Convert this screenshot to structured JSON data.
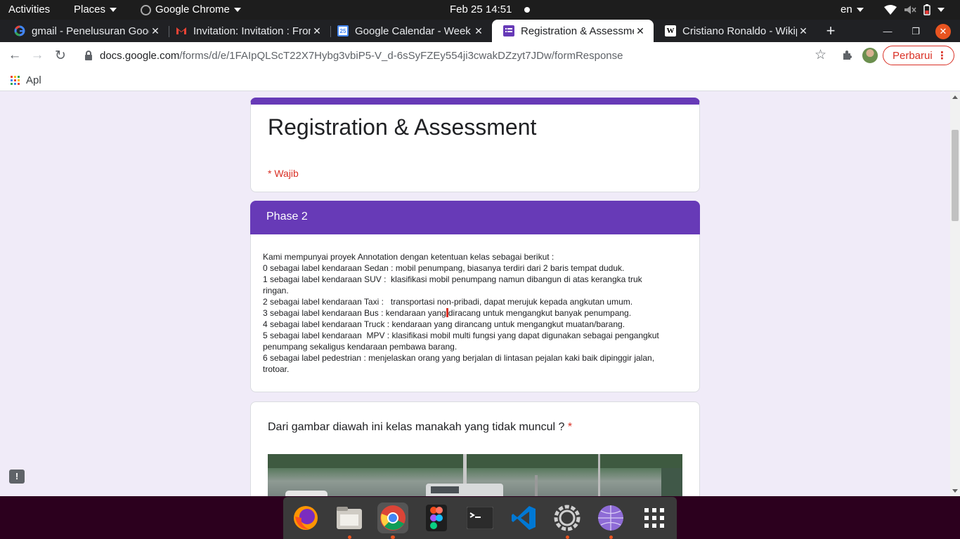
{
  "topbar": {
    "activities": "Activities",
    "places": "Places",
    "app": "Google Chrome",
    "datetime": "Feb 25  14:51",
    "lang": "en"
  },
  "tabs": [
    {
      "title": "gmail - Penelusuran Google",
      "icon": "google-icon"
    },
    {
      "title": "Invitation: Invitation : From",
      "icon": "gmail-icon"
    },
    {
      "title": "Google Calendar - Week",
      "icon": "calendar-icon"
    },
    {
      "title": "Registration & Assessment",
      "icon": "forms-icon",
      "active": true
    },
    {
      "title": "Cristiano Ronaldo - Wikipedia",
      "icon": "wikipedia-icon"
    }
  ],
  "toolbar": {
    "url_host": "docs.google.com",
    "url_path": "/forms/d/e/1FAIpQLScT22X7Hybg3vbiP5-V_d-6sSyFZEy554ji3cwakDZzyt7JDw/formResponse",
    "update_label": "Perbarui"
  },
  "bookmarks": {
    "apps_label": "Apl"
  },
  "form": {
    "title": "Registration & Assessment",
    "required_note": "* Wajib",
    "section_title": "Phase 2",
    "description": [
      "Kami mempunyai proyek Annotation dengan ketentuan kelas sebagai berikut :",
      "0 sebagai label kendaraan Sedan : mobil penumpang, biasanya terdiri dari 2 baris tempat duduk.",
      "1 sebagai label kendaraan SUV :  klasifikasi mobil penumpang namun dibangun di atas kerangka truk",
      "ringan.",
      "2 sebagai label kendaraan Taxi :   transportasi non-pribadi, dapat merujuk kepada angkutan umum.",
      "3 sebagai label kendaraan Bus : kendaraan yang",
      "diracang untuk mengangkut banyak penumpang.",
      "4 sebagai label kendaraan Truck : kendaraan yang dirancang untuk mengangkut muatan/barang.",
      "5 sebagai label kendaraan  MPV : klasifikasi mobil multi fungsi yang dapat digunakan sebagai pengangkut",
      "penumpang sekaligus kendaraan pembawa barang.",
      "6 sebagai label pedestrian : menjelaskan orang yang berjalan di lintasan pejalan kaki baik dipinggir jalan,",
      "trotoar."
    ],
    "question": "Dari gambar diawah ini kelas manakah yang tidak muncul ?",
    "question_required_mark": "*"
  },
  "colors": {
    "theme": "#673ab7",
    "required": "#d93025",
    "background": "#f0ebf8"
  },
  "dock": [
    "firefox-icon",
    "files-icon",
    "chrome-icon",
    "figma-icon",
    "terminal-icon",
    "vscode-icon",
    "settings-icon",
    "browser-icon",
    "app-grid-icon"
  ]
}
